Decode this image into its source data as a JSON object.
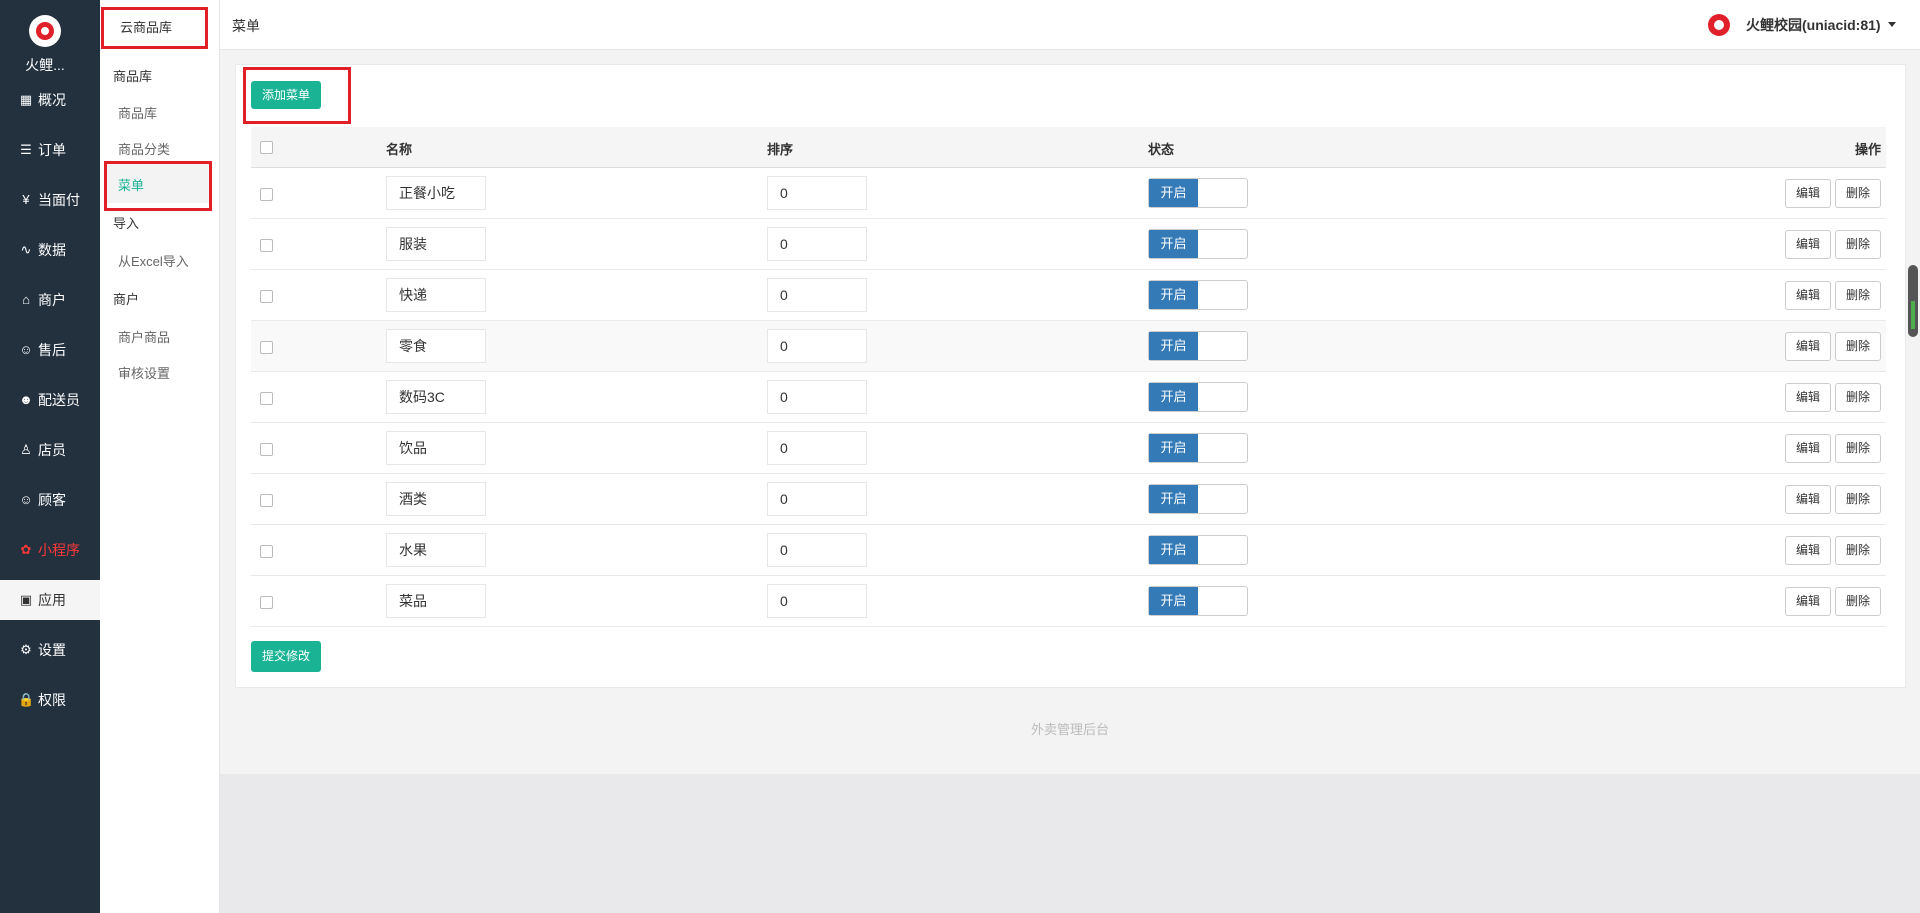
{
  "nav": {
    "brand": "火鲤...",
    "items": [
      {
        "label": "概况",
        "icon": "dashboard-icon",
        "glyph": "▦"
      },
      {
        "label": "订单",
        "icon": "order-icon",
        "glyph": "☰"
      },
      {
        "label": "当面付",
        "icon": "yen-icon",
        "glyph": "¥"
      },
      {
        "label": "数据",
        "icon": "chart-icon",
        "glyph": "∿"
      },
      {
        "label": "商户",
        "icon": "store-icon",
        "glyph": "⌂"
      },
      {
        "label": "售后",
        "icon": "service-icon",
        "glyph": "☺"
      },
      {
        "label": "配送员",
        "icon": "courier-icon",
        "glyph": "☻"
      },
      {
        "label": "店员",
        "icon": "clerk-icon",
        "glyph": "♙"
      },
      {
        "label": "顾客",
        "icon": "customer-icon",
        "glyph": "☺"
      },
      {
        "label": "小程序",
        "icon": "miniprogram-icon",
        "glyph": "✿"
      },
      {
        "label": "应用",
        "icon": "apps-icon",
        "glyph": "▣"
      },
      {
        "label": "设置",
        "icon": "gear-icon",
        "glyph": "⚙"
      },
      {
        "label": "权限",
        "icon": "lock-icon",
        "glyph": "🔒"
      }
    ]
  },
  "subnav": {
    "top_link": "云商品库",
    "group1": "商品库",
    "group1_items": [
      "商品库",
      "商品分类",
      "菜单"
    ],
    "group2": "导入",
    "group2_items": [
      "从Excel导入"
    ],
    "group3": "商户",
    "group3_items": [
      "商户商品",
      "审核设置"
    ]
  },
  "header": {
    "title": "菜单",
    "user": "火鲤校园(uniacid:81)"
  },
  "toolbar": {
    "add_label": "添加菜单",
    "submit_label": "提交修改"
  },
  "table": {
    "columns": [
      "名称",
      "排序",
      "状态",
      "操作"
    ],
    "switch_on": "开启",
    "edit_label": "编辑",
    "delete_label": "删除",
    "rows": [
      {
        "name": "正餐小吃",
        "sort": "0"
      },
      {
        "name": "服装",
        "sort": "0"
      },
      {
        "name": "快递",
        "sort": "0"
      },
      {
        "name": "零食",
        "sort": "0"
      },
      {
        "name": "数码3C",
        "sort": "0"
      },
      {
        "name": "饮品",
        "sort": "0"
      },
      {
        "name": "酒类",
        "sort": "0"
      },
      {
        "name": "水果",
        "sort": "0"
      },
      {
        "name": "菜品",
        "sort": "0"
      }
    ]
  },
  "footer": "外卖管理后台",
  "colors": {
    "nav_bg": "#23313f",
    "accent_green": "#1ab394",
    "switch_blue": "#337ab7",
    "highlight_red": "#e01f26",
    "brand_red": "#e0202a"
  }
}
